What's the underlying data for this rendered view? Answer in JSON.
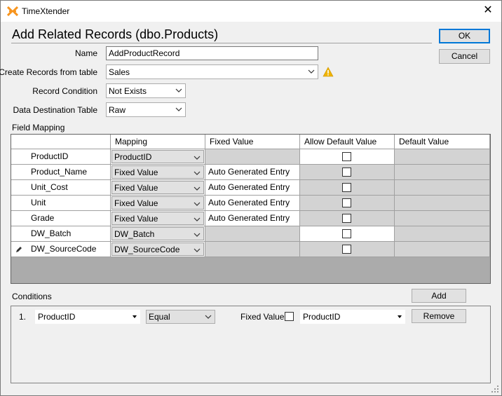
{
  "window": {
    "title": "TimeXtender",
    "heading": "Add Related Records (dbo.Products)"
  },
  "buttons": {
    "ok": "OK",
    "cancel": "Cancel",
    "add": "Add",
    "remove": "Remove"
  },
  "form": {
    "name_label": "Name",
    "name_value": "AddProductRecord",
    "create_from_label": "Create Records from table",
    "create_from_value": "Sales",
    "record_condition_label": "Record Condition",
    "record_condition_value": "Not Exists",
    "data_destination_label": "Data Destination Table",
    "data_destination_value": "Raw"
  },
  "field_mapping": {
    "section_label": "Field Mapping",
    "columns": [
      "Mapping",
      "Fixed Value",
      "Allow Default Value",
      "Default Value"
    ],
    "rows": [
      {
        "field": "ProductID",
        "mapping": "ProductID",
        "fixed_value": "",
        "allow_default": false,
        "fixed_active": false,
        "allow_active": true
      },
      {
        "field": "Product_Name",
        "mapping": "Fixed Value",
        "fixed_value": "Auto Generated Entry",
        "allow_default": false,
        "fixed_active": true,
        "allow_active": false
      },
      {
        "field": "Unit_Cost",
        "mapping": "Fixed Value",
        "fixed_value": "Auto Generated Entry",
        "allow_default": false,
        "fixed_active": true,
        "allow_active": false
      },
      {
        "field": "Unit",
        "mapping": "Fixed Value",
        "fixed_value": "Auto Generated Entry",
        "allow_default": false,
        "fixed_active": true,
        "allow_active": false
      },
      {
        "field": "Grade",
        "mapping": "Fixed Value",
        "fixed_value": "Auto Generated Entry",
        "allow_default": false,
        "fixed_active": true,
        "allow_active": false
      },
      {
        "field": "DW_Batch",
        "mapping": "DW_Batch",
        "fixed_value": "",
        "allow_default": false,
        "fixed_active": false,
        "allow_active": true
      },
      {
        "field": "DW_SourceCode",
        "mapping": "DW_SourceCode",
        "fixed_value": "",
        "allow_default": false,
        "fixed_active": false,
        "allow_active": false
      }
    ]
  },
  "conditions": {
    "section_label": "Conditions",
    "items": [
      {
        "index": "1.",
        "field": "ProductID",
        "operator": "Equal",
        "fixed_value_label": "Fixed Value",
        "fixed_value_checked": false,
        "value": "ProductID"
      }
    ]
  },
  "icons": {
    "app": "timextender-logo-icon",
    "close": "close-icon",
    "warning": "warning-icon",
    "dropdown": "chevron-down-icon",
    "edit": "pencil-icon",
    "resize": "resize-grip-icon"
  },
  "colors": {
    "accent": "#0078d7",
    "logo": "#f7941d",
    "warning": "#f0b400"
  }
}
